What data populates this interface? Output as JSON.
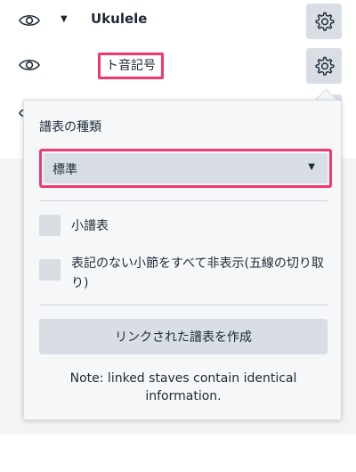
{
  "instruments": {
    "row1": {
      "name": "Ukulele"
    },
    "row2": {
      "clef": "ト音記号"
    }
  },
  "popup": {
    "title": "譜表の種類",
    "select_value": "標準",
    "checkbox_small_staff": "小譜表",
    "checkbox_hide_empty": "表記のない小節をすべて非表示(五線の切り取り)",
    "create_linked_button": "リンクされた譜表を作成",
    "note": "Note: linked staves contain identical information."
  },
  "colors": {
    "highlight": "#f2386e",
    "button_bg": "#d9dee5"
  }
}
